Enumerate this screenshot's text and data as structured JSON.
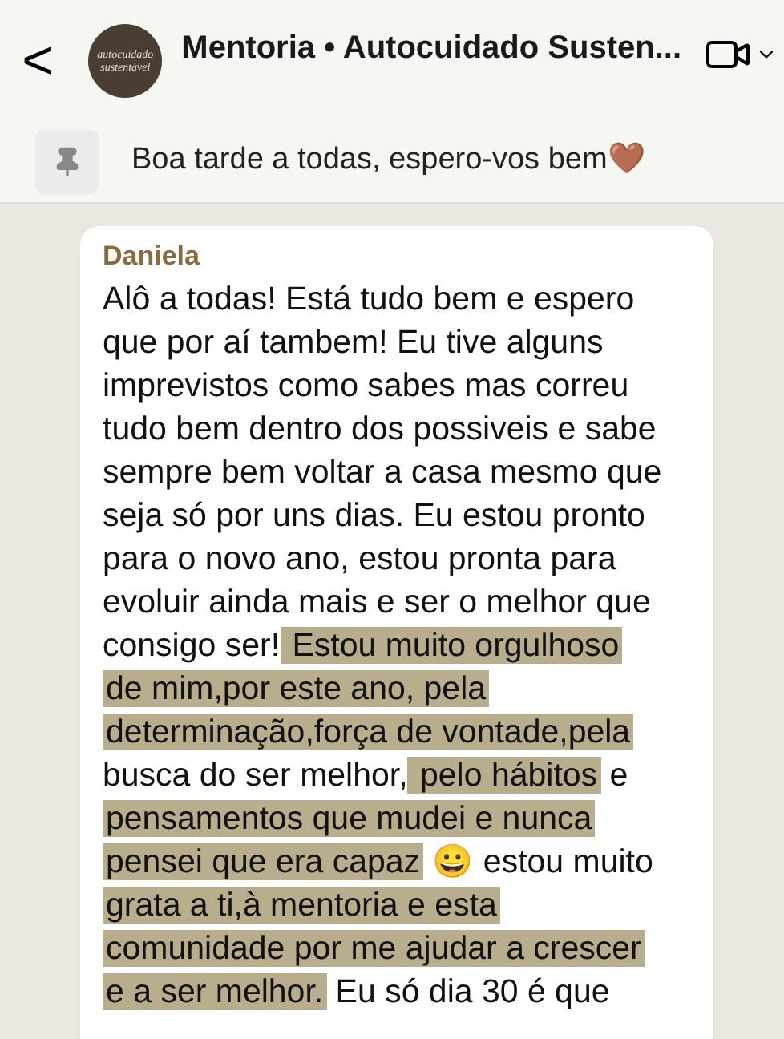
{
  "header": {
    "back": "<",
    "avatar_text": "autocuidado sustentável",
    "title": "Mentoria • Autocuidado Susten..."
  },
  "pinned": {
    "text": "Boa tarde a todas, espero-vos bem🤎"
  },
  "message": {
    "sender": "Daniela",
    "lines": [
      [
        {
          "text": "Alô a todas! Está tudo bem e espero",
          "highlighted": false
        }
      ],
      [
        {
          "text": "que por aí tambem! Eu tive alguns",
          "highlighted": false
        }
      ],
      [
        {
          "text": "imprevistos como sabes mas correu",
          "highlighted": false
        }
      ],
      [
        {
          "text": "tudo bem dentro dos possiveis e sabe",
          "highlighted": false
        }
      ],
      [
        {
          "text": "sempre bem voltar a casa mesmo que",
          "highlighted": false
        }
      ],
      [
        {
          "text": "seja só por uns dias. Eu estou pronto",
          "highlighted": false
        }
      ],
      [
        {
          "text": "para o novo ano, estou pronta para",
          "highlighted": false
        }
      ],
      [
        {
          "text": "evoluir ainda mais e ser o melhor que",
          "highlighted": false
        }
      ],
      [
        {
          "text": "consigo ser!",
          "highlighted": false
        },
        {
          "text": "Estou muito orgulhoso",
          "highlighted": true
        }
      ],
      [
        {
          "text": "de mim,por este ano, pela",
          "highlighted": true
        }
      ],
      [
        {
          "text": "determinação,força de vontade,pela",
          "highlighted": true
        }
      ],
      [
        {
          "text": "busca do ser melhor,",
          "highlighted": false
        },
        {
          "text": "pelo hábitos",
          "highlighted": true
        },
        {
          "text": "e",
          "highlighted": false
        }
      ],
      [
        {
          "text": "pensamentos que mudei e nunca",
          "highlighted": true
        }
      ],
      [
        {
          "text": "pensei que era capaz",
          "highlighted": true
        },
        {
          "text": "😀 estou muito",
          "highlighted": false
        }
      ],
      [
        {
          "text": "grata a ti,à mentoria e esta",
          "highlighted": true
        }
      ],
      [
        {
          "text": "comunidade por me ajudar a crescer",
          "highlighted": true
        }
      ],
      [
        {
          "text": "e a ser melhor.",
          "highlighted": true
        },
        {
          "text": "Eu só dia 30 é que",
          "highlighted": false
        }
      ]
    ]
  }
}
